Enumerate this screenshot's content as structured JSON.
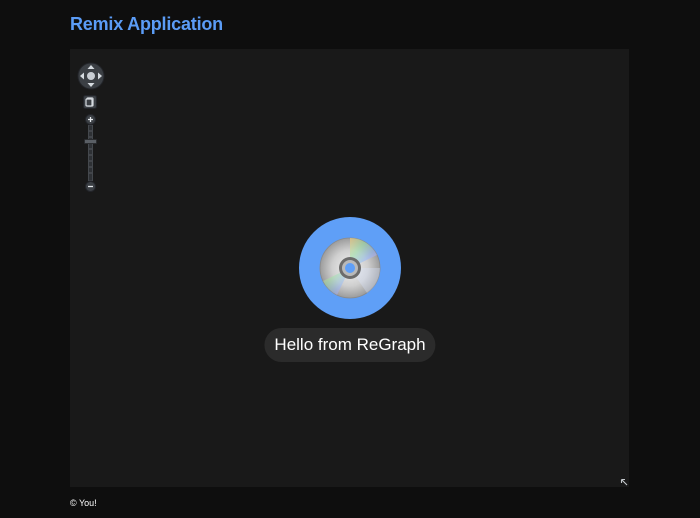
{
  "header": {
    "title": "Remix Application"
  },
  "graph": {
    "node": {
      "label": "Hello from ReGraph",
      "color": "#5f9ff7",
      "glyph": "cd-disc-icon"
    },
    "label_background": "#2b2b2b",
    "canvas_background": "#191919",
    "controls": {
      "nav": "pan-arrows-icon",
      "fit": "fit-to-window-icon",
      "zoom_in": "zoom-in-icon",
      "zoom_out": "zoom-out-icon",
      "zoom_level": 0.72,
      "expand": "expand-corner-icon"
    }
  },
  "footer": {
    "text": "© You!"
  },
  "colors": {
    "page_background": "#0e0e0e",
    "accent": "#5b9cf6"
  }
}
